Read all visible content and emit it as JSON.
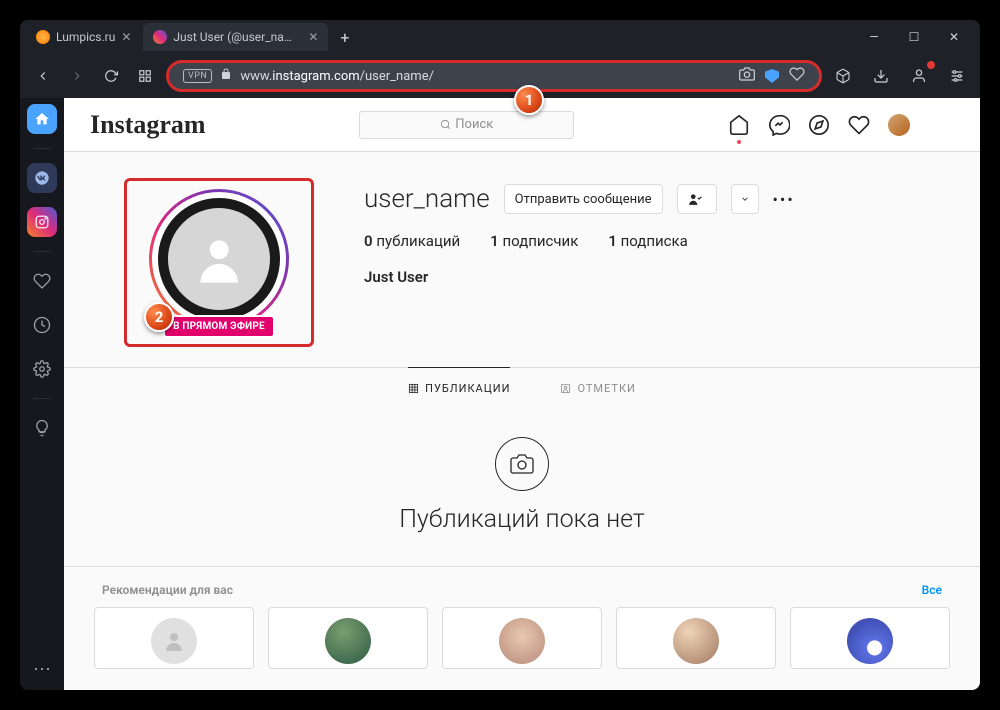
{
  "tabs": {
    "tab1": {
      "title": "Lumpics.ru"
    },
    "tab2": {
      "title": "Just User (@user_name) •"
    }
  },
  "address": {
    "vpn": "VPN",
    "prefix": "www.",
    "domain": "instagram.com",
    "path": "/user_name/"
  },
  "instagram": {
    "logo": "Instagram",
    "search_placeholder": "Поиск",
    "profile": {
      "username": "user_name",
      "message_btn": "Отправить сообщение",
      "live_badge": "В ПРЯМОМ ЭФИРЕ",
      "stats": {
        "posts_count": "0",
        "posts_label": "публикаций",
        "followers_count": "1",
        "followers_label": "подписчик",
        "following_count": "1",
        "following_label": "подписка"
      },
      "fullname": "Just User"
    },
    "tabs": {
      "posts": "ПУБЛИКАЦИИ",
      "tagged": "ОТМЕТКИ"
    },
    "empty": "Публикаций пока нет",
    "reco": {
      "title": "Рекомендации для вас",
      "all": "Все"
    }
  },
  "markers": {
    "m1": "1",
    "m2": "2"
  }
}
